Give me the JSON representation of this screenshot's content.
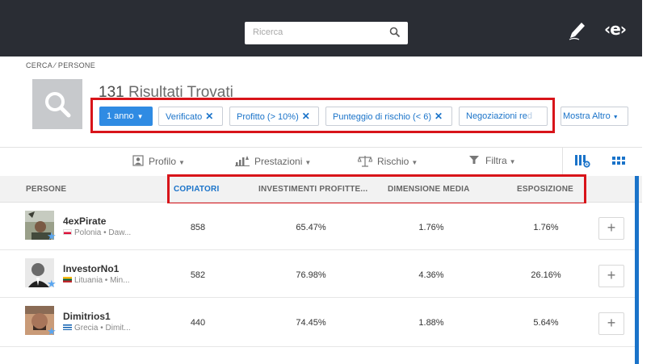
{
  "topbar": {
    "search_placeholder": "Ricerca",
    "logo_text": "‹e›"
  },
  "header": {
    "breadcrumb": "CERCA ⁄ PERSONE",
    "results_count": "131",
    "results_label": "Risultati Trovati"
  },
  "filters": {
    "period": "1 anno",
    "chips": [
      "Verificato",
      "Profitto (> 10%)",
      "Punteggio di rischio (< 6)"
    ],
    "trades_chip": "Negoziazioni re",
    "trades_chip_faded": "d",
    "more": "Mostra Altro"
  },
  "toolbar": {
    "profile": "Profilo",
    "performance": "Prestazioni",
    "risk": "Rischio",
    "filter": "Filtra"
  },
  "columns": {
    "people": "PERSONE",
    "copiers": "COPIATORI",
    "profitable": "INVESTIMENTI PROFITTE...",
    "avg_size": "DIMENSIONE MEDIA",
    "exposure": "ESPOSIZIONE"
  },
  "rows": [
    {
      "name": "4exPirate",
      "meta": "Polonia • Daw...",
      "copiers": "858",
      "profitable": "65.47%",
      "avg_size": "1.76%",
      "exposure": "1.76%",
      "flag": "poland"
    },
    {
      "name": "InvestorNo1",
      "meta": "Lituania • Min...",
      "copiers": "582",
      "profitable": "76.98%",
      "avg_size": "4.36%",
      "exposure": "26.16%",
      "flag": "lithuania"
    },
    {
      "name": "Dimitrios1",
      "meta": "Grecia • Dimit...",
      "copiers": "440",
      "profitable": "74.45%",
      "avg_size": "1.88%",
      "exposure": "5.64%",
      "flag": "greece"
    }
  ],
  "icons": {
    "search": "search-icon",
    "edit": "pencil-icon",
    "star": "star-icon",
    "add": "plus-icon",
    "grid_view": "grid-icon",
    "column_settings": "column-settings-icon"
  },
  "colors": {
    "accent": "#1a73c9",
    "primary_chip": "#2f8be3",
    "highlight_box": "#d8141a",
    "topbar": "#2a2d34"
  },
  "add_label": "+"
}
